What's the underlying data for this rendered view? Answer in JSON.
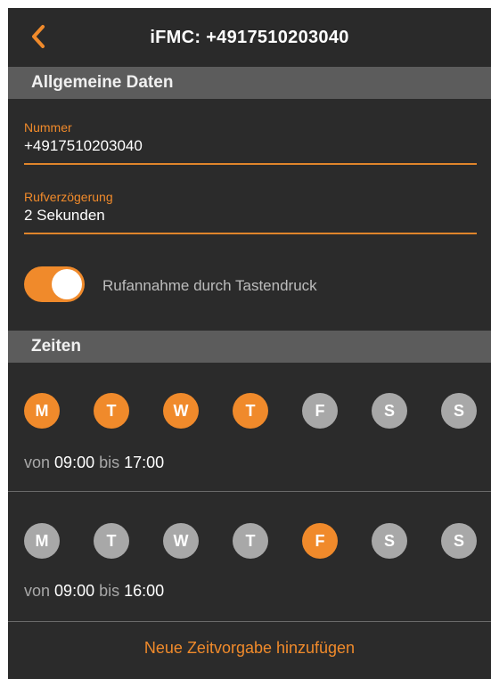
{
  "header": {
    "title": "iFMC: +4917510203040",
    "back_icon": "chevron-left-icon"
  },
  "sections": {
    "general": "Allgemeine Daten",
    "times": "Zeiten"
  },
  "fields": {
    "number": {
      "label": "Nummer",
      "value": "+4917510203040"
    },
    "delay": {
      "label": "Rufverzögerung",
      "value": "2 Sekunden"
    }
  },
  "toggle": {
    "label": "Rufannahme durch Tastendruck",
    "enabled": true
  },
  "schedules": [
    {
      "days": [
        {
          "letter": "M",
          "active": true
        },
        {
          "letter": "T",
          "active": true
        },
        {
          "letter": "W",
          "active": true
        },
        {
          "letter": "T",
          "active": true
        },
        {
          "letter": "F",
          "active": false
        },
        {
          "letter": "S",
          "active": false
        },
        {
          "letter": "S",
          "active": false
        }
      ],
      "from_word": "von",
      "from": "09:00",
      "to_word": "bis",
      "to": "17:00"
    },
    {
      "days": [
        {
          "letter": "M",
          "active": false
        },
        {
          "letter": "T",
          "active": false
        },
        {
          "letter": "W",
          "active": false
        },
        {
          "letter": "T",
          "active": false
        },
        {
          "letter": "F",
          "active": true
        },
        {
          "letter": "S",
          "active": false
        },
        {
          "letter": "S",
          "active": false
        }
      ],
      "from_word": "von",
      "from": "09:00",
      "to_word": "bis",
      "to": "16:00"
    }
  ],
  "add_button": "Neue Zeitvorgabe hinzufügen",
  "colors": {
    "accent": "#f08a2b",
    "inactive": "#a8a8a8",
    "background": "#2b2b2b",
    "section": "#5c5c5c"
  }
}
